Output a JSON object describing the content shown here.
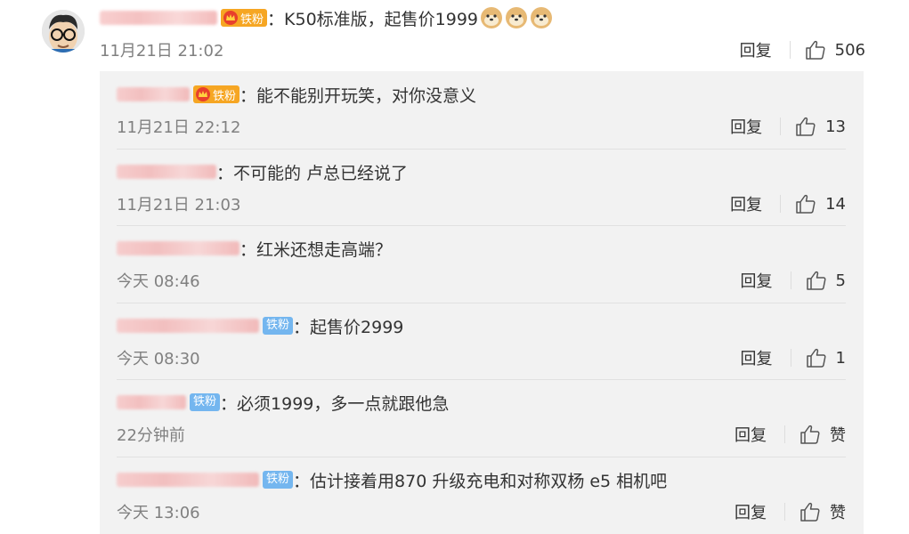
{
  "main": {
    "badge": "铁粉",
    "text": "：K50标准版，起售价1999",
    "time": "11月21日 21:02",
    "reply_label": "回复",
    "likes": "506"
  },
  "replies": [
    {
      "badge_type": "crown",
      "badge": "铁粉",
      "text": "：能不能别开玩笑，对你没意义",
      "time": "11月21日 22:12",
      "reply_label": "回复",
      "likes": "13"
    },
    {
      "badge_type": "none",
      "badge": "",
      "text": "：不可能的 卢总已经说了",
      "time": "11月21日 21:03",
      "reply_label": "回复",
      "likes": "14"
    },
    {
      "badge_type": "none",
      "badge": "",
      "text": "：红米还想走高端？",
      "time": "今天 08:46",
      "reply_label": "回复",
      "likes": "5"
    },
    {
      "badge_type": "iron",
      "badge": "铁粉",
      "text": "：起售价2999",
      "time": "今天 08:30",
      "reply_label": "回复",
      "likes": "1"
    },
    {
      "badge_type": "iron",
      "badge": "铁粉",
      "text": "：必须1999，多一点就跟他急",
      "time": "22分钟前",
      "reply_label": "回复",
      "likes": "赞"
    },
    {
      "badge_type": "iron",
      "badge": "铁粉",
      "text": "：估计接着用870 升级充电和对称双杨 e5 相机吧",
      "time": "今天 13:06",
      "reply_label": "回复",
      "likes": "赞"
    }
  ],
  "colors": {
    "crown_badge": "#f6a623",
    "iron_badge": "#74b6ef",
    "reply_bg": "#f2f2f2"
  },
  "icons": {
    "like": "thumbs-up-icon",
    "crown": "crown-icon",
    "emoji": "doge-emoji-icon"
  }
}
